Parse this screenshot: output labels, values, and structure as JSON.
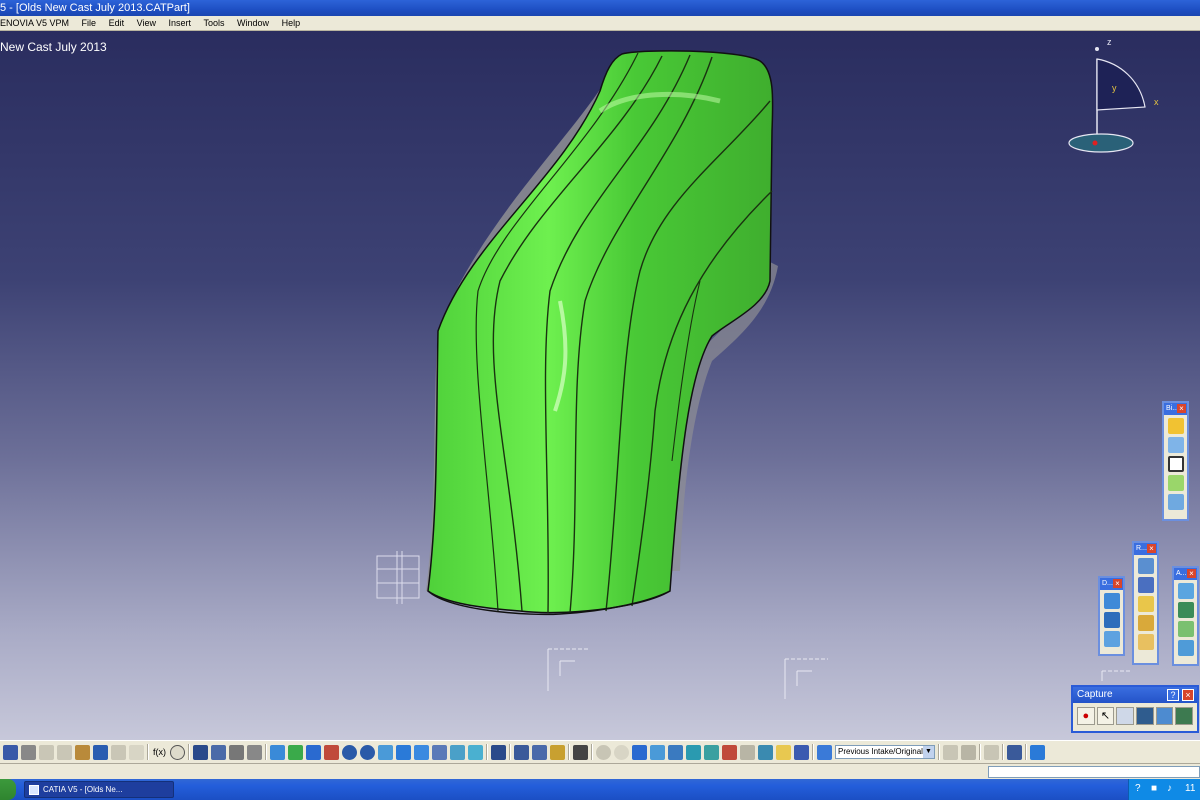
{
  "window": {
    "title": "5 - [Olds New Cast July 2013.CATPart]"
  },
  "menu": [
    "ENOVIA V5 VPM",
    "File",
    "Edit",
    "View",
    "Insert",
    "Tools",
    "Window",
    "Help"
  ],
  "viewport": {
    "document_label": "New Cast July 2013"
  },
  "compass": {
    "x_label": "x",
    "y_label": "y",
    "z_label": "z"
  },
  "floating_toolbars": {
    "bi": {
      "title": "Bi..."
    },
    "r": {
      "title": "R..."
    },
    "d": {
      "title": "D..."
    },
    "a": {
      "title": "A..."
    }
  },
  "capture": {
    "title": "Capture"
  },
  "bottom_toolbar": {
    "layer_value": "Previous Intake/Original",
    "fx_label": "f(x)"
  },
  "taskbar": {
    "task_label": "CATIA V5 - [Olds Ne...",
    "clock": "11"
  }
}
